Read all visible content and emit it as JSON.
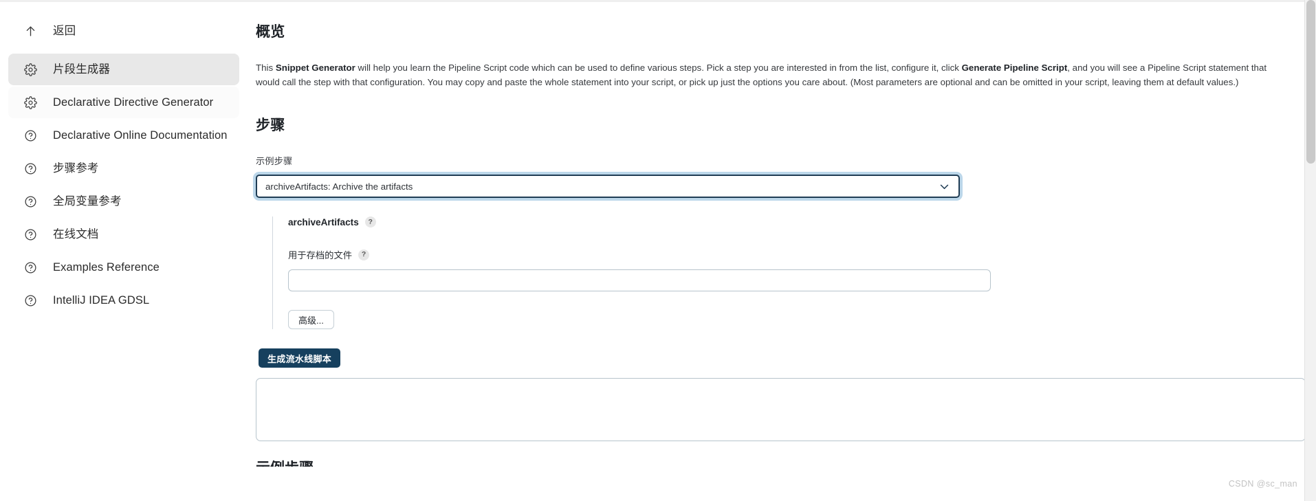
{
  "sidebar": {
    "back": {
      "label": "返回",
      "icon": "arrow-up-icon"
    },
    "items": [
      {
        "label": "片段生成器",
        "icon": "gear-icon",
        "state": "active"
      },
      {
        "label": "Declarative Directive Generator",
        "icon": "gear-icon",
        "state": "subtle"
      },
      {
        "label": "Declarative Online Documentation",
        "icon": "question-circle-icon",
        "state": "normal"
      },
      {
        "label": "步骤参考",
        "icon": "question-circle-icon",
        "state": "normal"
      },
      {
        "label": "全局变量参考",
        "icon": "question-circle-icon",
        "state": "normal"
      },
      {
        "label": "在线文档",
        "icon": "question-circle-icon",
        "state": "normal"
      },
      {
        "label": "Examples Reference",
        "icon": "question-circle-icon",
        "state": "normal"
      },
      {
        "label": "IntelliJ IDEA GDSL",
        "icon": "question-circle-icon",
        "state": "normal"
      }
    ]
  },
  "main": {
    "overview_title": "概览",
    "intro": {
      "p1": "This ",
      "bold1": "Snippet Generator",
      "p2": " will help you learn the Pipeline Script code which can be used to define various steps. Pick a step you are interested in from the list, configure it, click ",
      "bold2": "Generate Pipeline Script",
      "p3": ", and you will see a Pipeline Script statement that would call the step with that configuration. You may copy and paste the whole statement into your script, or pick up just the options you care about. (Most parameters are optional and can be omitted in your script, leaving them at default values.)"
    },
    "steps_title": "步骤",
    "sample_step_label": "示例步骤",
    "sample_step_value": "archiveArtifacts: Archive the artifacts",
    "chevron_icon": "chevron-down-icon",
    "form": {
      "block_title": "archiveArtifacts",
      "block_help": "?",
      "field_label": "用于存档的文件",
      "field_help": "?",
      "field_value": "",
      "field_placeholder": "",
      "advanced_button": "高级..."
    },
    "generate_button": "生成流水线脚本",
    "output_value": "",
    "output_placeholder": "",
    "cut_heading": "示例步骤"
  },
  "watermark": "CSDN @sc_man",
  "colors": {
    "accent": "#16405e",
    "focus_ring": "#bcd7ea",
    "sidebar_active": "#e8e8e8",
    "border": "#b7c4cc"
  }
}
